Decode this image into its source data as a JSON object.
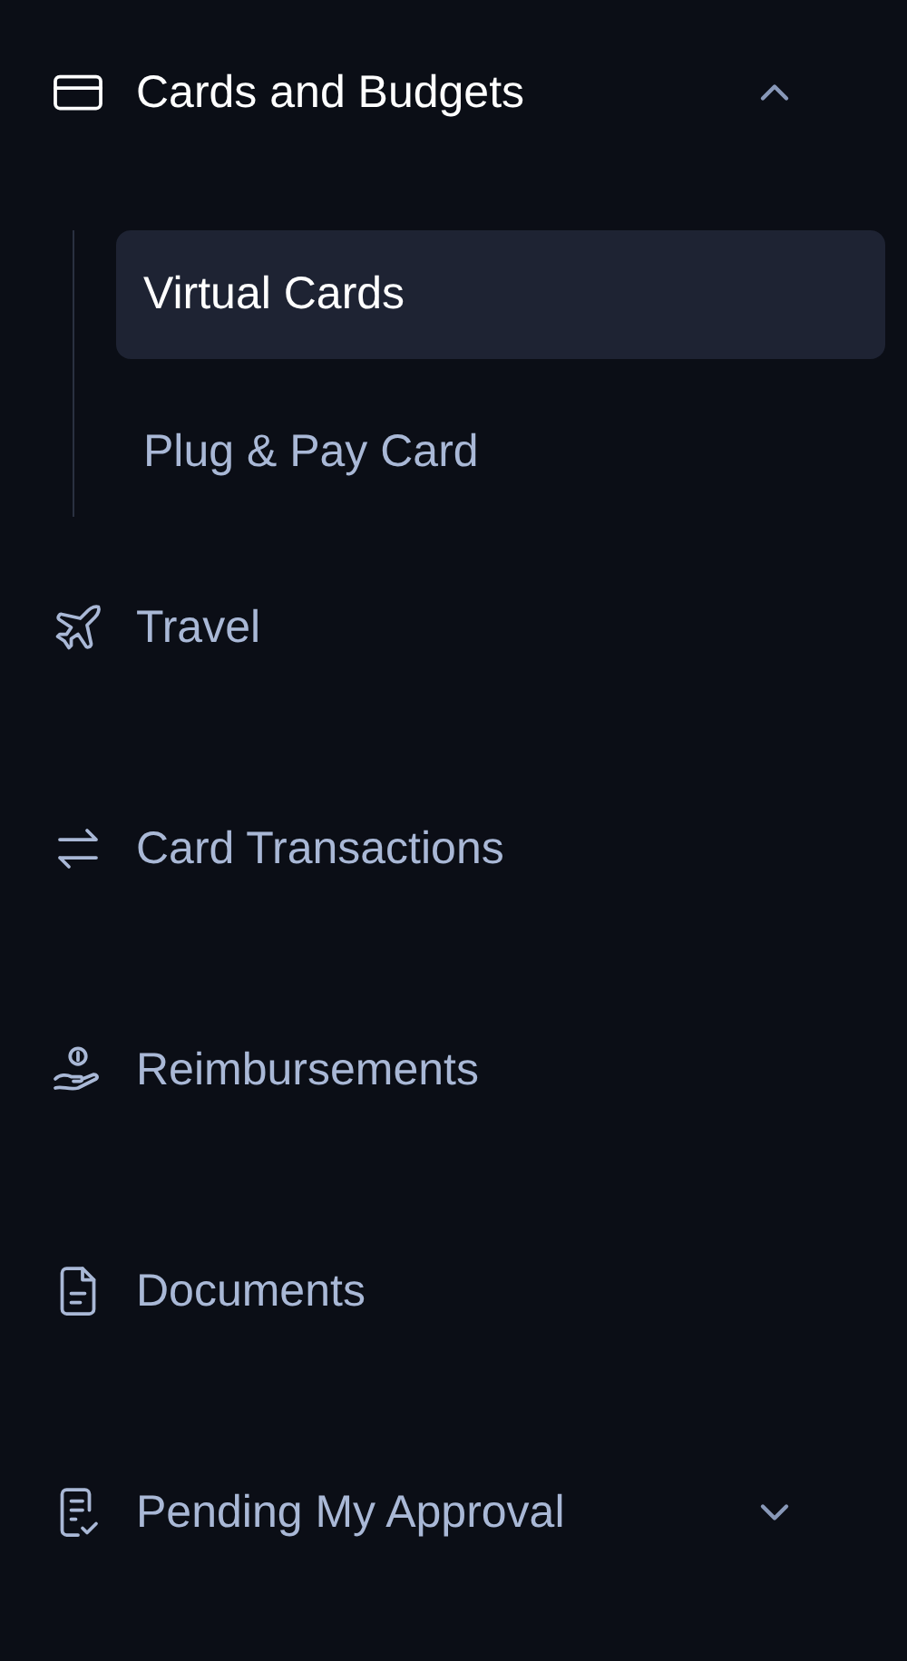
{
  "nav": [
    {
      "label": "Cards and Budgets",
      "expanded": true,
      "children": [
        {
          "label": "Virtual Cards",
          "selected": true
        },
        {
          "label": "Plug & Pay Card",
          "selected": false
        }
      ]
    },
    {
      "label": "Travel"
    },
    {
      "label": "Card Transactions"
    },
    {
      "label": "Reimbursements"
    },
    {
      "label": "Documents"
    },
    {
      "label": "Pending My Approval",
      "expanded": false
    }
  ]
}
